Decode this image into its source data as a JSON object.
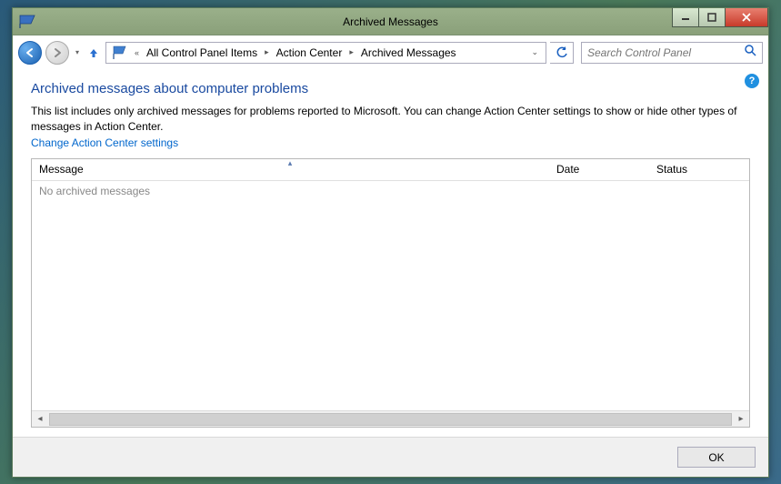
{
  "window": {
    "title": "Archived Messages"
  },
  "toolbar": {
    "breadcrumbs": {
      "root_indicator": "«",
      "item0": "All Control Panel Items",
      "item1": "Action Center",
      "item2": "Archived Messages"
    },
    "search_placeholder": "Search Control Panel"
  },
  "page": {
    "heading": "Archived messages about computer problems",
    "description": "This list includes only archived messages for problems reported to Microsoft. You can change Action Center settings to show or hide other types of messages in Action Center.",
    "link": "Change Action Center settings"
  },
  "list": {
    "columns": {
      "message": "Message",
      "date": "Date",
      "status": "Status"
    },
    "empty_text": "No archived messages"
  },
  "footer": {
    "ok": "OK"
  }
}
